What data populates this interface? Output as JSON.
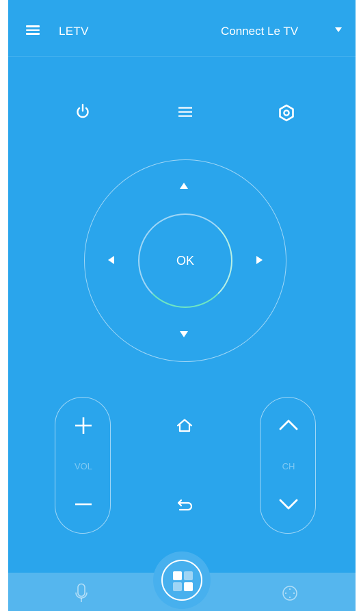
{
  "header": {
    "title": "LETV",
    "connect_label": "Connect Le TV",
    "menu_icon": "hamburger-menu-icon",
    "dropdown_icon": "caret-down-icon"
  },
  "controls": {
    "power_icon": "power-icon",
    "menu_icon": "list-menu-icon",
    "settings_icon": "settings-gear-icon"
  },
  "dpad": {
    "ok_label": "OK",
    "up_icon": "arrow-up-icon",
    "down_icon": "arrow-down-icon",
    "left_icon": "arrow-left-icon",
    "right_icon": "arrow-right-icon"
  },
  "volume": {
    "label": "VOL",
    "plus_icon": "plus-icon",
    "minus_icon": "minus-icon"
  },
  "channel": {
    "label": "CH",
    "up_icon": "chevron-up-icon",
    "down_icon": "chevron-down-icon"
  },
  "center": {
    "home_icon": "home-icon",
    "back_icon": "back-arrow-icon"
  },
  "bottom_nav": {
    "voice_icon": "microphone-icon",
    "apps_icon": "apps-grid-icon",
    "touchpad_icon": "touchpad-icon"
  },
  "colors": {
    "background": "#2aa5ec",
    "bottom_bar": "#55b6ee",
    "ok_ring_accent": "#6fe6c2",
    "apps_tile_a": "#ffffff",
    "apps_tile_b": "#9fd5f5"
  }
}
